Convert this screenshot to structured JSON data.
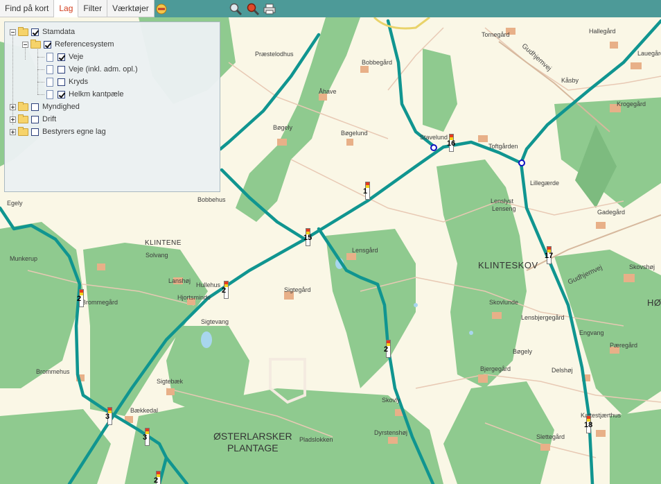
{
  "toolbar": {
    "tabs": [
      {
        "label": "Find på kort",
        "active": false
      },
      {
        "label": "Lag",
        "active": true
      },
      {
        "label": "Filter",
        "active": false
      },
      {
        "label": "Værktøjer",
        "active": false
      }
    ],
    "icons": [
      "collapse-icon",
      "zoom-tool-icon",
      "search-zoom-icon",
      "print-icon"
    ],
    "colors": {
      "bar": "#4d9a98",
      "active_tab_text": "#d23c1c"
    }
  },
  "layers": {
    "stamdata": {
      "label": "Stamdata",
      "checked": true,
      "expanded": true
    },
    "referencesystem": {
      "label": "Referencesystem",
      "checked": true,
      "expanded": true
    },
    "veje": {
      "label": "Veje",
      "checked": true
    },
    "veje_adm": {
      "label": "Veje (inkl. adm. opl.)",
      "checked": false
    },
    "kryds": {
      "label": "Kryds",
      "checked": false
    },
    "helkm": {
      "label": "Helkm kantpæle",
      "checked": true
    },
    "myndighed": {
      "label": "Myndighed",
      "checked": false,
      "expanded": false
    },
    "drift": {
      "label": "Drift",
      "checked": false,
      "expanded": false
    },
    "bestyrer": {
      "label": "Bestyrers egne lag",
      "checked": false,
      "expanded": false
    }
  },
  "map": {
    "colors": {
      "road": "#109590",
      "forest": "#8fca8f",
      "background": "#faf7e6",
      "building": "#e8b088"
    },
    "area_labels": {
      "klintene": "KLINTENE",
      "klinteskov": "KLINTESKOV",
      "ho": "HØ",
      "plantage": "ØSTERLARSKER\nPLANTAGE"
    },
    "road_names": {
      "gudhjemvej_1": "Gudhjemvej",
      "gudhjemvej_2": "Gudhjemvej"
    },
    "places": {
      "tornegaard": "Tornegård",
      "hallegaard": "Hallegård",
      "lauegaard": "Lauegård",
      "praestelodhus": "Præstelodhus",
      "bobbegaard": "Bobbegård",
      "kaasby": "Kåsby",
      "aahave": "Åhave",
      "krogegaard": "Krogegård",
      "boegely": "Bøgely",
      "boegelund": "Bøgelund",
      "stavelund": "Stavelund",
      "toftgaarden": "Toftgården",
      "lillegaerde": "Lillegærde",
      "egely": "Egely",
      "bobbehus": "Bobbehus",
      "lenslyst": "Lenslyst",
      "lenseng": "Lenseng",
      "gadegaard": "Gadegård",
      "lensgaard": "Lensgård",
      "munkerup": "Munkerup",
      "solvang": "Solvang",
      "skovshoej": "Skovshøj",
      "lanshoej": "Lanshøj",
      "hullehus": "Hullehus",
      "sigtegaard": "Sigtegård",
      "hjortsminde": "Hjortsminde",
      "skovlunde": "Skovlunde",
      "brommegaard": "Brommegård",
      "lensbjergegaard": "Lensbjergegård",
      "sigtevang": "Sigtevang",
      "engvang": "Engvang",
      "paeregaard": "Pæregård",
      "boegely2": "Bøgely",
      "brommehus": "Brommehus",
      "bjergegaard": "Bjergegård",
      "delshoej": "Delshøj",
      "sigtebaek": "Sigtebæk",
      "skovly": "Skovly",
      "baekkedal": "Bækkedal",
      "dyrstenshoej": "Dyrstenshøj",
      "kattestjaerthus": "Kattestjærthus",
      "pladslokken": "Pladslokken",
      "slettegaard": "Slettegård"
    },
    "markers": {
      "m1": "1",
      "m15": "15",
      "m16": "16",
      "m17": "17",
      "m18": "18",
      "m2a": "2",
      "m2b": "2",
      "m2c": "2",
      "m2d": "2",
      "m3a": "3",
      "m3b": "3"
    }
  }
}
